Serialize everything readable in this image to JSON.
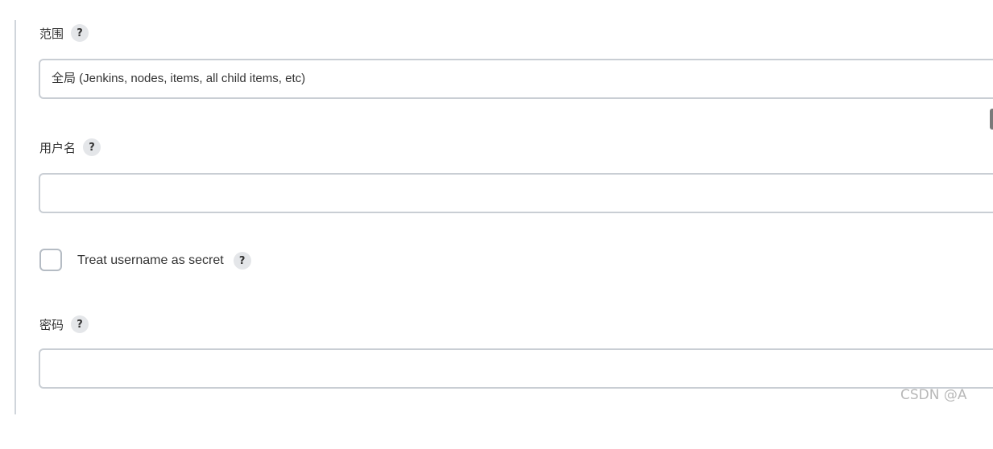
{
  "scope": {
    "label": "范围",
    "help": "?",
    "value": "全局 (Jenkins, nodes, items, all child items, etc)"
  },
  "username": {
    "label": "用户名",
    "help": "?",
    "value": ""
  },
  "treat_secret": {
    "label": "Treat username as secret",
    "help": "?",
    "checked": false
  },
  "password": {
    "label": "密码",
    "help": "?",
    "value": ""
  },
  "watermark": "CSDN @A"
}
